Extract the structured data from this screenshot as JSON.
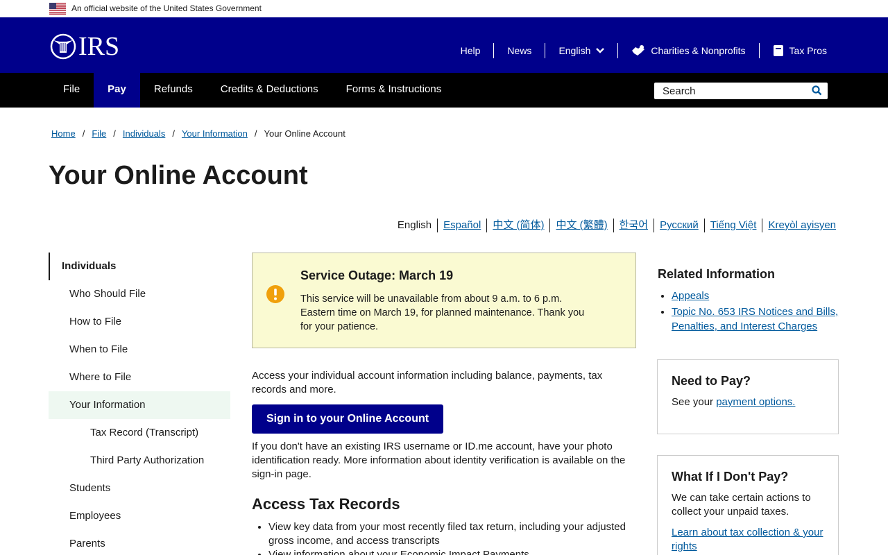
{
  "gov_banner": {
    "text": "An official website of the United States Government"
  },
  "header": {
    "logo_text": "IRS",
    "utility": [
      {
        "label": "Help"
      },
      {
        "label": "News"
      },
      {
        "label": "English"
      },
      {
        "label": "Charities & Nonprofits"
      },
      {
        "label": "Tax Pros"
      }
    ]
  },
  "nav": {
    "items": [
      {
        "label": "File"
      },
      {
        "label": "Pay"
      },
      {
        "label": "Refunds"
      },
      {
        "label": "Credits & Deductions"
      },
      {
        "label": "Forms & Instructions"
      }
    ],
    "search_placeholder": "Search"
  },
  "breadcrumb": {
    "items": [
      "Home",
      "File",
      "Individuals",
      "Your Information"
    ],
    "current": "Your Online Account"
  },
  "page_title": "Your Online Account",
  "languages": {
    "current": "English",
    "links": [
      "Español",
      "中文 (简体)",
      "中文 (繁體)",
      "한국어",
      "Русский",
      "Tiếng Việt",
      "Kreyòl ayisyen"
    ]
  },
  "sidebar": {
    "top": "Individuals",
    "items": [
      "Who Should File",
      "How to File",
      "When to File",
      "Where to File",
      "Your Information"
    ],
    "sub": [
      "Tax Record (Transcript)",
      "Third Party Authorization"
    ],
    "more": [
      "Students",
      "Employees",
      "Parents"
    ]
  },
  "alert": {
    "title": "Service Outage: March 19",
    "body": "This service will be unavailable from about 9 a.m. to 6 p.m. Eastern time on March 19, for planned maintenance. Thank you for your patience."
  },
  "main": {
    "intro": "Access your individual account information including balance, payments, tax records and more.",
    "signin_label": "Sign in to your Online Account",
    "para2": "If you don't have an existing IRS username or ID.me account, have your photo identification ready. More information about identity verification is available on the sign-in page.",
    "h2": "Access Tax Records",
    "bullets": [
      "View key data from your most recently filed tax return, including your adjusted gross income, and access transcripts",
      "View information about your Economic Impact Payments"
    ]
  },
  "related": {
    "title": "Related Information",
    "links": [
      "Appeals",
      "Topic No. 653 IRS Notices and Bills, Penalties, and Interest Charges"
    ]
  },
  "need_to_pay": {
    "title": "Need to Pay?",
    "text_prefix": "See your ",
    "link": "payment options."
  },
  "dont_pay": {
    "title": "What If I Don't Pay?",
    "text": "We can take certain actions to collect your unpaid taxes.",
    "link": "Learn about tax collection & your rights"
  }
}
